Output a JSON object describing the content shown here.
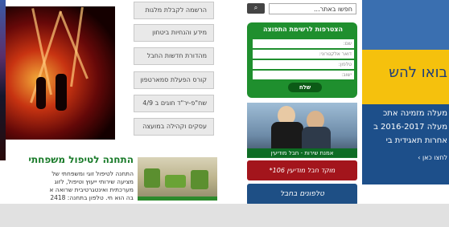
{
  "search": {
    "placeholder": "חפשו באתר...",
    "button_label": "⌕"
  },
  "menu": {
    "items": [
      {
        "label": "הרשמה לקבלת מלגות"
      },
      {
        "label": "מידע והנחיות ביטחון"
      },
      {
        "label": "מהדורת חדשות החבל"
      },
      {
        "label": "קורס הפעלת סמארטפון"
      },
      {
        "label": "שח\"פ-יר\"ד חוגים ב 4/9"
      },
      {
        "label": "עסקים וקהילה במועצה"
      }
    ]
  },
  "subscribe": {
    "title": "הצטרפות לרשימת התפוצה",
    "fields": [
      "שם:",
      "דואר אלקטרוני:",
      "טלפון:",
      "ישוב:"
    ],
    "send_label": "שלח"
  },
  "phone_photo": {
    "caption": "אמנת שירות - חבל מודיעין"
  },
  "banners": {
    "red": "מוקד חבל מודיעין 106*",
    "blue": "טלפונים בחבל"
  },
  "article": {
    "heading": "התחנה לטיפול משפחתי",
    "lines": [
      "התחנה לטיפול זוגי ומשפחתי של",
      "מציעה שירותי ייעוץ וטיפול, לזוג",
      "מערכתית ואינטגרטיבית שרואה א",
      "בה הוא חי. טלפון בתחנה: 2418"
    ]
  },
  "right_ad": {
    "headline": "בואו להש",
    "lines": [
      "מעלה מזמינה אתכ",
      "מעלה 2016-2017 ב",
      "אחרות תאגידית בי",
      "לחצו כאן ›"
    ]
  },
  "colors": {
    "green": "#1f8f2e",
    "red": "#a3151c",
    "blue": "#1e4f85",
    "yellow": "#f5c10d"
  }
}
